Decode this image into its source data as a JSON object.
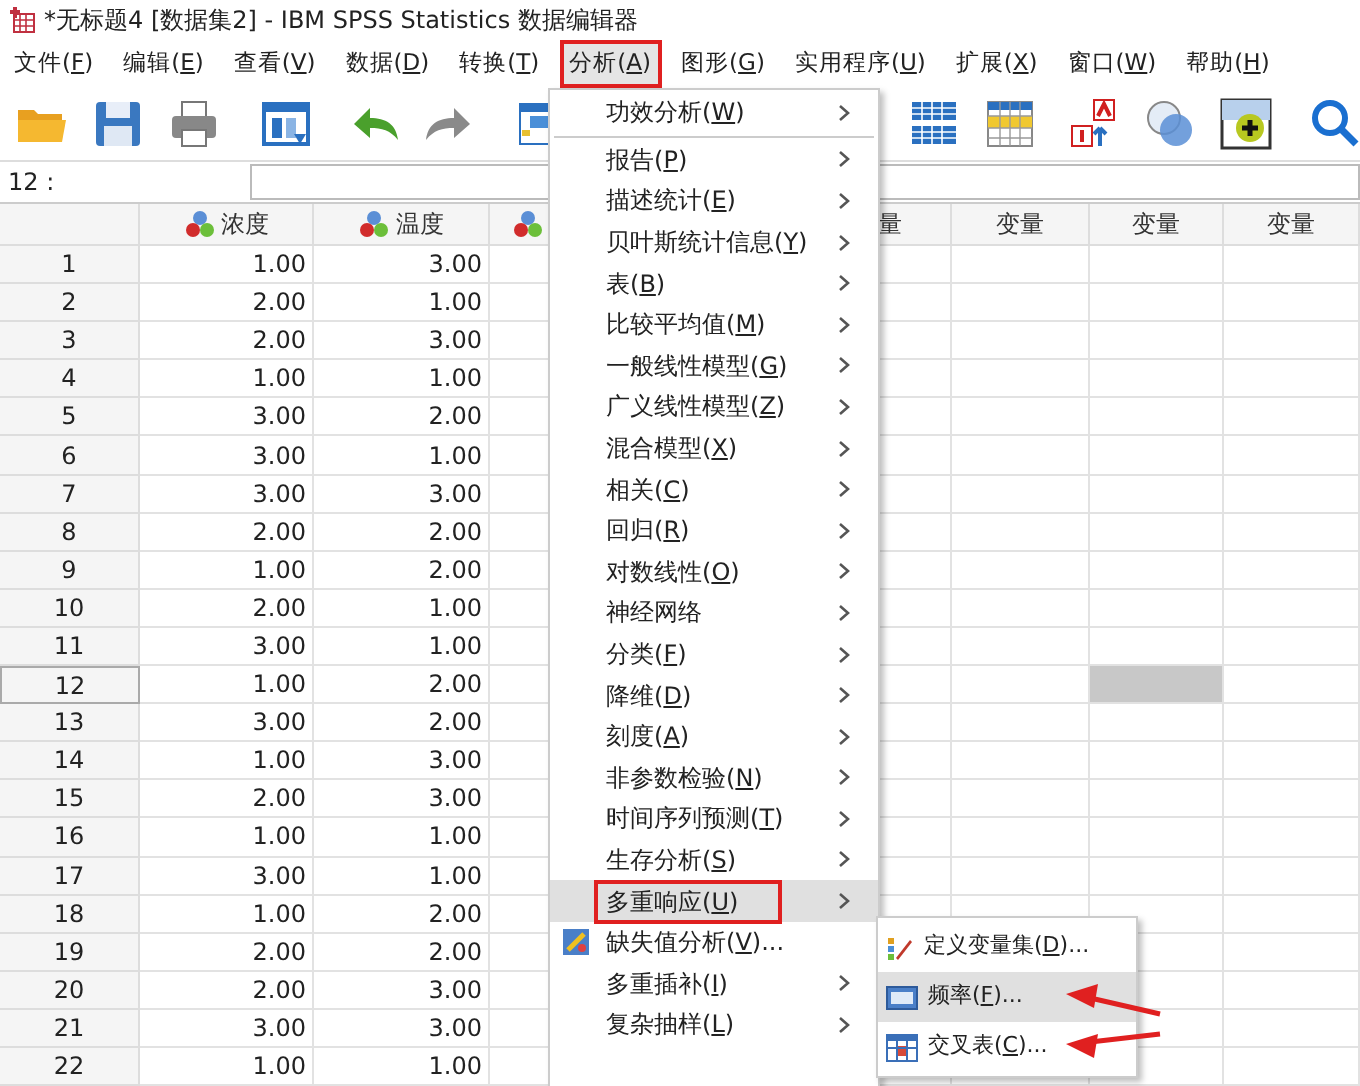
{
  "window": {
    "title": "*无标题4 [数据集2] - IBM SPSS Statistics 数据编辑器"
  },
  "menubar": [
    {
      "label": "文件(F)",
      "selected": false,
      "outlined": false
    },
    {
      "label": "编辑(E)",
      "selected": false,
      "outlined": false
    },
    {
      "label": "查看(V)",
      "selected": false,
      "outlined": false
    },
    {
      "label": "数据(D)",
      "selected": false,
      "outlined": false
    },
    {
      "label": "转换(T)",
      "selected": false,
      "outlined": false
    },
    {
      "label": "分析(A)",
      "selected": true,
      "outlined": true
    },
    {
      "label": "图形(G)",
      "selected": false,
      "outlined": false
    },
    {
      "label": "实用程序(U)",
      "selected": false,
      "outlined": false
    },
    {
      "label": "扩展(X)",
      "selected": false,
      "outlined": false
    },
    {
      "label": "窗口(W)",
      "selected": false,
      "outlined": false
    },
    {
      "label": "帮助(H)",
      "selected": false,
      "outlined": false
    }
  ],
  "cell_ref": {
    "label": "12 :"
  },
  "grid": {
    "columns": [
      {
        "kind": "variable",
        "label": "浓度"
      },
      {
        "kind": "variable",
        "label": "温度"
      },
      {
        "kind": "variable"
      },
      {
        "kind": "empty"
      },
      {
        "kind": "cut",
        "label": "量"
      },
      {
        "kind": "empty",
        "label": "变量"
      },
      {
        "kind": "empty",
        "label": "变量",
        "current": true
      },
      {
        "kind": "empty",
        "label": "变量"
      }
    ],
    "rows": [
      {
        "number": "1",
        "selected": false,
        "values": [
          "1.00",
          "3.00"
        ]
      },
      {
        "number": "2",
        "selected": false,
        "values": [
          "2.00",
          "1.00"
        ]
      },
      {
        "number": "3",
        "selected": false,
        "values": [
          "2.00",
          "3.00"
        ]
      },
      {
        "number": "4",
        "selected": false,
        "values": [
          "1.00",
          "1.00"
        ]
      },
      {
        "number": "5",
        "selected": false,
        "values": [
          "3.00",
          "2.00"
        ]
      },
      {
        "number": "6",
        "selected": false,
        "values": [
          "3.00",
          "1.00"
        ]
      },
      {
        "number": "7",
        "selected": false,
        "values": [
          "3.00",
          "3.00"
        ]
      },
      {
        "number": "8",
        "selected": false,
        "values": [
          "2.00",
          "2.00"
        ]
      },
      {
        "number": "9",
        "selected": false,
        "values": [
          "1.00",
          "2.00"
        ]
      },
      {
        "number": "10",
        "selected": false,
        "values": [
          "2.00",
          "1.00"
        ]
      },
      {
        "number": "11",
        "selected": false,
        "values": [
          "3.00",
          "1.00"
        ]
      },
      {
        "number": "12",
        "selected": true,
        "values": [
          "1.00",
          "2.00"
        ]
      },
      {
        "number": "13",
        "selected": false,
        "values": [
          "3.00",
          "2.00"
        ]
      },
      {
        "number": "14",
        "selected": false,
        "values": [
          "1.00",
          "3.00"
        ]
      },
      {
        "number": "15",
        "selected": false,
        "values": [
          "2.00",
          "3.00"
        ]
      },
      {
        "number": "16",
        "selected": false,
        "values": [
          "1.00",
          "1.00"
        ]
      },
      {
        "number": "17",
        "selected": false,
        "values": [
          "3.00",
          "1.00"
        ]
      },
      {
        "number": "18",
        "selected": false,
        "values": [
          "1.00",
          "2.00"
        ]
      },
      {
        "number": "19",
        "selected": false,
        "values": [
          "2.00",
          "2.00"
        ]
      },
      {
        "number": "20",
        "selected": false,
        "values": [
          "2.00",
          "3.00"
        ]
      },
      {
        "number": "21",
        "selected": false,
        "values": [
          "3.00",
          "3.00"
        ]
      },
      {
        "number": "22",
        "selected": false,
        "values": [
          "1.00",
          "1.00"
        ]
      }
    ]
  },
  "analyze_menu": {
    "items": [
      {
        "kind": "submenu",
        "label": "功效分析(W)",
        "selected": false,
        "outlined": false,
        "separator_after": true
      },
      {
        "kind": "submenu",
        "label": "报告(P)",
        "selected": false,
        "outlined": false,
        "separator_after": false
      },
      {
        "kind": "submenu",
        "label": "描述统计(E)",
        "selected": false,
        "outlined": false,
        "separator_after": false
      },
      {
        "kind": "submenu",
        "label": "贝叶斯统计信息(Y)",
        "selected": false,
        "outlined": false,
        "separator_after": false
      },
      {
        "kind": "submenu",
        "label": "表(B)",
        "selected": false,
        "outlined": false,
        "separator_after": false
      },
      {
        "kind": "submenu",
        "label": "比较平均值(M)",
        "selected": false,
        "outlined": false,
        "separator_after": false
      },
      {
        "kind": "submenu",
        "label": "一般线性模型(G)",
        "selected": false,
        "outlined": false,
        "separator_after": false
      },
      {
        "kind": "submenu",
        "label": "广义线性模型(Z)",
        "selected": false,
        "outlined": false,
        "separator_after": false
      },
      {
        "kind": "submenu",
        "label": "混合模型(X)",
        "selected": false,
        "outlined": false,
        "separator_after": false
      },
      {
        "kind": "submenu",
        "label": "相关(C)",
        "selected": false,
        "outlined": false,
        "separator_after": false
      },
      {
        "kind": "submenu",
        "label": "回归(R)",
        "selected": false,
        "outlined": false,
        "separator_after": false
      },
      {
        "kind": "submenu",
        "label": "对数线性(O)",
        "selected": false,
        "outlined": false,
        "separator_after": false
      },
      {
        "kind": "submenu",
        "label": "神经网络",
        "selected": false,
        "outlined": false,
        "separator_after": false
      },
      {
        "kind": "submenu",
        "label": "分类(F)",
        "selected": false,
        "outlined": false,
        "separator_after": false
      },
      {
        "kind": "submenu",
        "label": "降维(D)",
        "selected": false,
        "outlined": false,
        "separator_after": false
      },
      {
        "kind": "submenu",
        "label": "刻度(A)",
        "selected": false,
        "outlined": false,
        "separator_after": false
      },
      {
        "kind": "submenu",
        "label": "非参数检验(N)",
        "selected": false,
        "outlined": false,
        "separator_after": false
      },
      {
        "kind": "submenu",
        "label": "时间序列预测(T)",
        "selected": false,
        "outlined": false,
        "separator_after": false
      },
      {
        "kind": "submenu",
        "label": "生存分析(S)",
        "selected": false,
        "outlined": false,
        "separator_after": false
      },
      {
        "kind": "submenu",
        "label": "多重响应(U)",
        "selected": true,
        "outlined": true,
        "separator_after": false
      },
      {
        "kind": "action",
        "label": "缺失值分析(V)...",
        "selected": false,
        "outlined": false,
        "separator_after": false
      },
      {
        "kind": "submenu",
        "label": "多重插补(I)",
        "selected": false,
        "outlined": false,
        "separator_after": false
      },
      {
        "kind": "submenu",
        "label": "复杂抽样(L)",
        "selected": false,
        "outlined": false,
        "separator_after": false
      }
    ]
  },
  "submenu": {
    "items": [
      {
        "kind": "define",
        "label": "定义变量集(D)...",
        "selected": false,
        "arrow": false
      },
      {
        "kind": "frequency",
        "label": "频率(F)...",
        "selected": true,
        "arrow": true
      },
      {
        "kind": "crosstab",
        "label": "交叉表(C)...",
        "selected": false,
        "arrow": true
      }
    ]
  }
}
